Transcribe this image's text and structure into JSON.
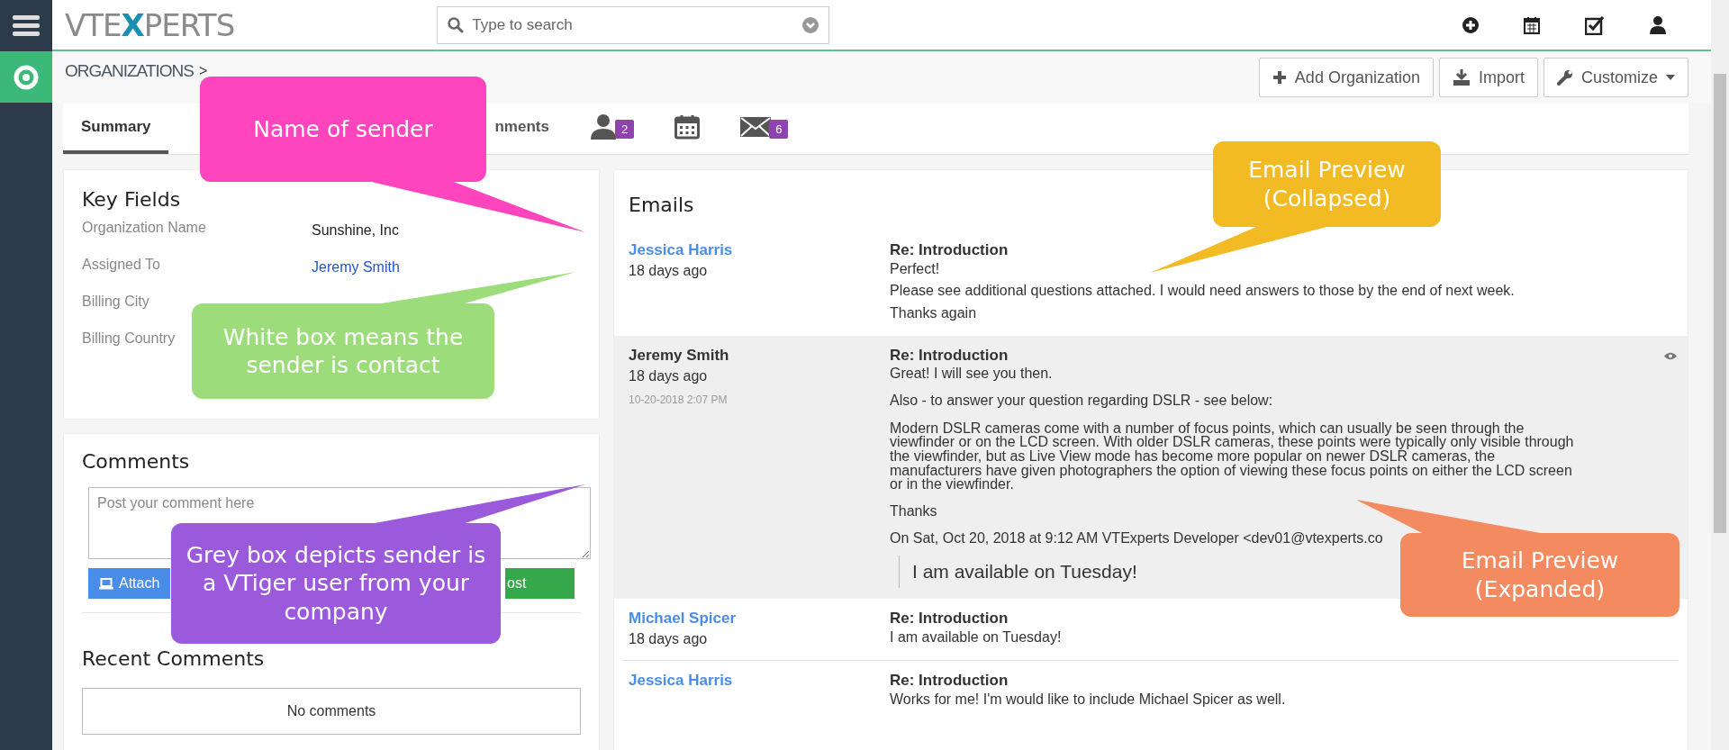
{
  "top_bar": {
    "logo": {
      "before": "VTE",
      "mark": "X",
      "after": "PERTS"
    },
    "search": {
      "placeholder": "Type to search"
    }
  },
  "breadcrumb": {
    "module": "ORGANIZATIONS",
    "separator": ">"
  },
  "actions": [
    {
      "kind": "add",
      "label": "Add Organization"
    },
    {
      "kind": "import",
      "label": "Import"
    },
    {
      "kind": "customize",
      "label": "Customize"
    }
  ],
  "tabs": [
    {
      "kind": "text",
      "label": "Summary",
      "selected": true
    },
    {
      "kind": "text",
      "label": "nments",
      "selected": false
    },
    {
      "kind": "contacts",
      "count": "2",
      "selected": false
    },
    {
      "kind": "calendar",
      "selected": false
    },
    {
      "kind": "emails",
      "count": "6",
      "selected": false
    }
  ],
  "key_fields": {
    "title": "Key Fields",
    "fields": [
      {
        "label": "Organization Name",
        "value": "Sunshine, Inc",
        "link": false
      },
      {
        "label": "Assigned To",
        "value": "Jeremy Smith",
        "link": true
      },
      {
        "label": "Billing City"
      },
      {
        "label": "Billing Country"
      }
    ]
  },
  "comments": {
    "title": "Comments",
    "placeholder": "Post your comment here",
    "attach": "Attach",
    "post": "ost",
    "recent_title": "Recent Comments",
    "empty": "No comments"
  },
  "emails": {
    "title": "Emails",
    "items": [
      {
        "sender": "Jessica Harris",
        "internal_user": false,
        "age": "18 days ago",
        "subject": "Re: Introduction",
        "expanded": false,
        "lines": [
          "Perfect!",
          "Please see additional questions attached. I would need answers to those by the end of next week.",
          "Thanks again"
        ]
      },
      {
        "sender": "Jeremy Smith",
        "internal_user": true,
        "age": "18 days ago",
        "date": "10-20-2018 2:07 PM",
        "subject": "Re: Introduction",
        "expanded": true,
        "lines": [
          "Great! I will see you then.",
          "Also - to answer your question regarding DSLR - see below:",
          "Modern DSLR cameras come with a number of focus points, which can usually be seen through the viewfinder or on the LCD screen. With older DSLR cameras, these points were typically only visible through the viewfinder, but as Live View mode has become more popular on newer DSLR cameras, the manufacturers have given photographers the option of viewing these focus points on either the LCD screen or in the viewfinder.",
          "Thanks",
          "On Sat, Oct 20, 2018 at 9:12 AM VTExperts Developer <dev01@vtexperts.co"
        ],
        "quote": "I am available on Tuesday!"
      },
      {
        "sender": "Michael Spicer",
        "internal_user": false,
        "age": "18 days ago",
        "subject": "Re: Introduction",
        "expanded": false,
        "lines": [
          "I am available on Tuesday!"
        ]
      },
      {
        "sender": "Jessica Harris",
        "internal_user": false,
        "subject": "Re: Introduction",
        "expanded": false,
        "lines": [
          "Works for me! I'm would like to include Michael Spicer as well."
        ]
      }
    ]
  },
  "callouts": [
    {
      "text": "Name of sender",
      "color": "#ff45be"
    },
    {
      "text": "White box means the sender is contact",
      "color": "#9ddc7a"
    },
    {
      "text": "Grey box depicts sender is a VTiger user from your company",
      "color": "#9b59db"
    },
    {
      "text": "Email Preview (Collapsed)",
      "color": "#f3bb23"
    },
    {
      "text": "Email Preview (Expanded)",
      "color": "#f48a60"
    }
  ]
}
